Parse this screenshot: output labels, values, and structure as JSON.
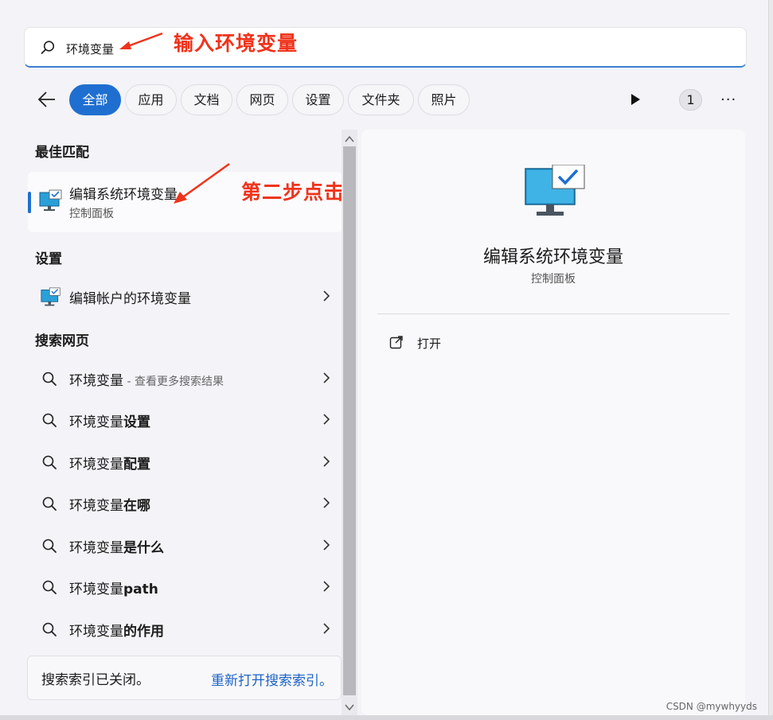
{
  "search": {
    "query": "环境变量",
    "annotation": "输入环境变量"
  },
  "annotation2": "第二步点击",
  "filters": {
    "tabs": [
      {
        "label": "全部",
        "active": true
      },
      {
        "label": "应用"
      },
      {
        "label": "文档"
      },
      {
        "label": "网页"
      },
      {
        "label": "设置"
      },
      {
        "label": "文件夹"
      },
      {
        "label": "照片"
      }
    ],
    "badge": "1",
    "more": "···"
  },
  "left": {
    "best_match_heading": "最佳匹配",
    "best_match": {
      "title": "编辑系统环境变量",
      "subtitle": "控制面板"
    },
    "settings_heading": "设置",
    "settings_item": "编辑帐户的环境变量",
    "web_heading": "搜索网页",
    "web_items": [
      {
        "prefix": "环境变量",
        "bold": "",
        "hint": " - 查看更多搜索结果"
      },
      {
        "prefix": "环境变量",
        "bold": "设置",
        "hint": ""
      },
      {
        "prefix": "环境变量",
        "bold": "配置",
        "hint": ""
      },
      {
        "prefix": "环境变量",
        "bold": "在哪",
        "hint": ""
      },
      {
        "prefix": "环境变量",
        "bold": "是什么",
        "hint": ""
      },
      {
        "prefix": "环境变量",
        "bold": "path",
        "hint": ""
      },
      {
        "prefix": "环境变量",
        "bold": "的作用",
        "hint": ""
      }
    ],
    "footer_text": "搜索索引已关闭。",
    "footer_link": "重新打开搜索索引。"
  },
  "detail": {
    "title": "编辑系统环境变量",
    "subtitle": "控制面板",
    "action_open": "打开"
  },
  "watermark": "CSDN @mywhyyds",
  "colors": {
    "accent": "#1f6fd1",
    "annotation": "#f0331b"
  }
}
